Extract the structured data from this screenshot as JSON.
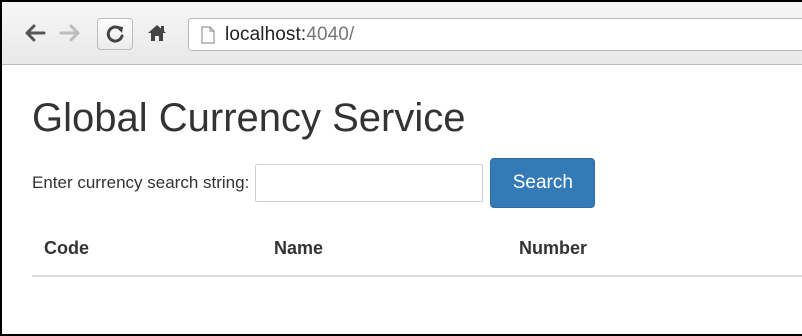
{
  "browser": {
    "url_host": "localhost:",
    "url_port": "4040/"
  },
  "page": {
    "title": "Global Currency Service",
    "search": {
      "label": "Enter currency search string:",
      "value": "",
      "placeholder": "",
      "button_label": "Search"
    },
    "table": {
      "columns": [
        "Code",
        "Name",
        "Number"
      ],
      "rows": []
    }
  },
  "colors": {
    "primary_button": "#337ab7",
    "text": "#333333"
  },
  "icons": [
    "back-arrow-icon",
    "forward-arrow-icon",
    "reload-icon",
    "home-icon",
    "page-icon"
  ]
}
